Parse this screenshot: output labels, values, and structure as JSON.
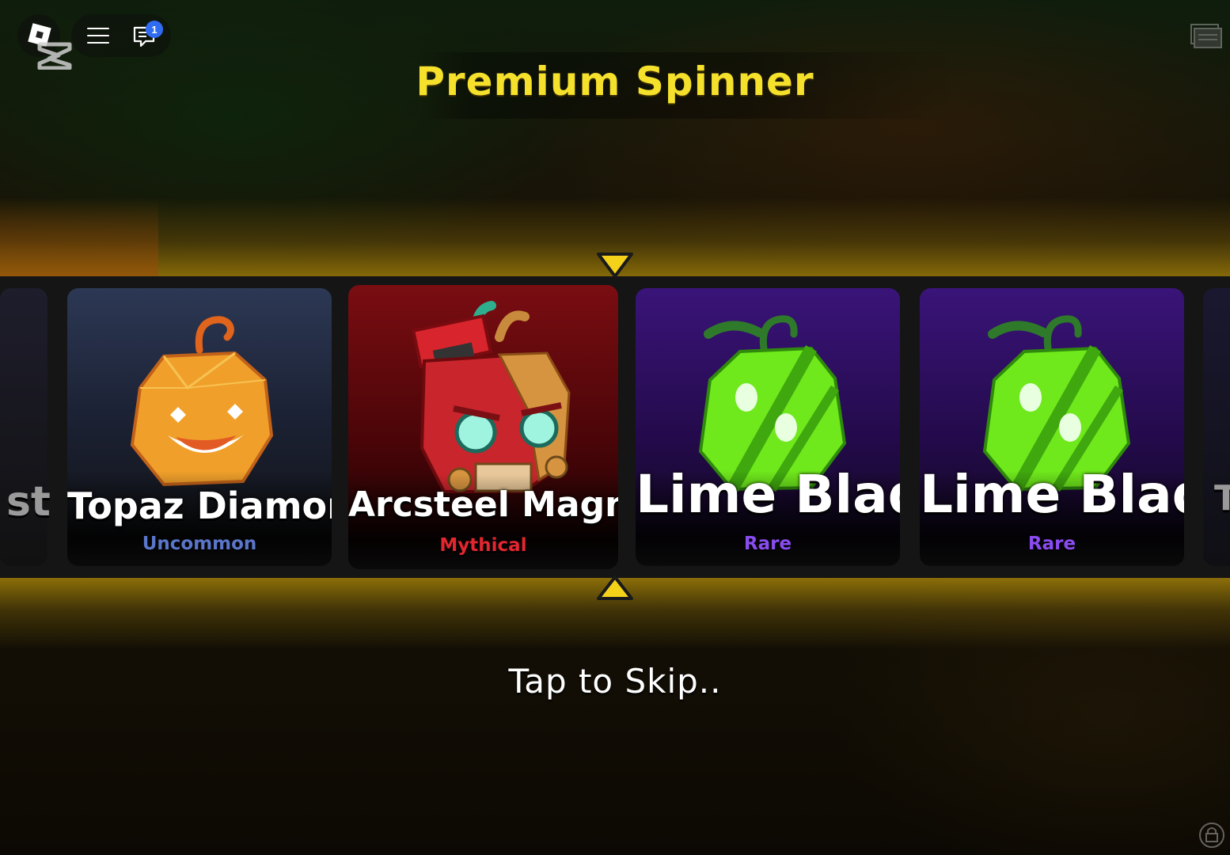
{
  "topbar": {
    "chat_badge_count": "1",
    "icons": [
      "roblox-menu-icon",
      "hamburger-menu-icon",
      "chat-icon"
    ]
  },
  "spinner": {
    "title": "Premium Spinner",
    "skip_hint": "Tap to Skip..",
    "left_edge_text": "st",
    "right_edge_text": "T",
    "items": [
      {
        "name": "Topaz Diamond",
        "rarity": "Uncommon",
        "rarity_color": "#5b76c9"
      },
      {
        "name": "Arcsteel Magnet",
        "rarity": "Mythical",
        "rarity_color": "#e3262f"
      },
      {
        "name": "Lime Blade",
        "rarity": "Rare",
        "rarity_color": "#8a4cf0"
      },
      {
        "name": "Lime Blade",
        "rarity": "Rare",
        "rarity_color": "#8a4cf0"
      }
    ]
  },
  "colors": {
    "title": "#f5e02c",
    "pointer": "#f5d21a",
    "highlight_band": "#aa870a"
  }
}
